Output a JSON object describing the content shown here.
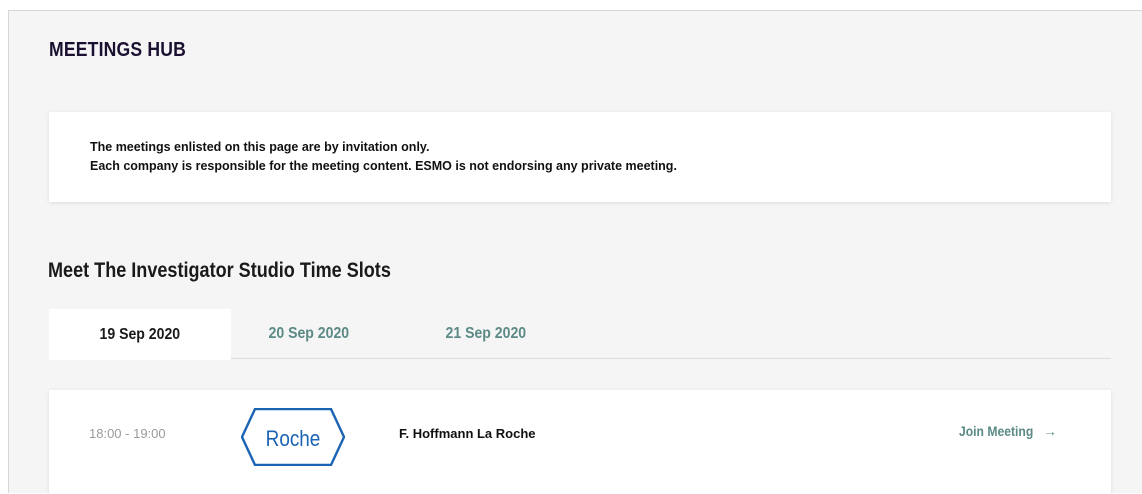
{
  "header": {
    "title": "MEETINGS HUB"
  },
  "notice": {
    "line1": "The meetings enlisted on this page are by invitation only.",
    "line2": "Each company is responsible for the meeting content. ESMO is not endorsing any private meeting."
  },
  "section": {
    "title": "Meet The Investigator Studio Time Slots",
    "tabs": [
      {
        "label": "19 Sep 2020",
        "active": true
      },
      {
        "label": "20 Sep 2020",
        "active": false
      },
      {
        "label": "21 Sep 2020",
        "active": false
      }
    ]
  },
  "slots": [
    {
      "time": "18:00 - 19:00",
      "logo_text": "Roche",
      "company": "F. Hoffmann La Roche",
      "action_label": "Join Meeting",
      "action_icon": "arrow-right-icon"
    }
  ],
  "colors": {
    "accent": "#5b8a86",
    "roche_blue": "#1b64b4",
    "title_dark": "#1c1030",
    "page_bg": "#f5f5f5"
  }
}
